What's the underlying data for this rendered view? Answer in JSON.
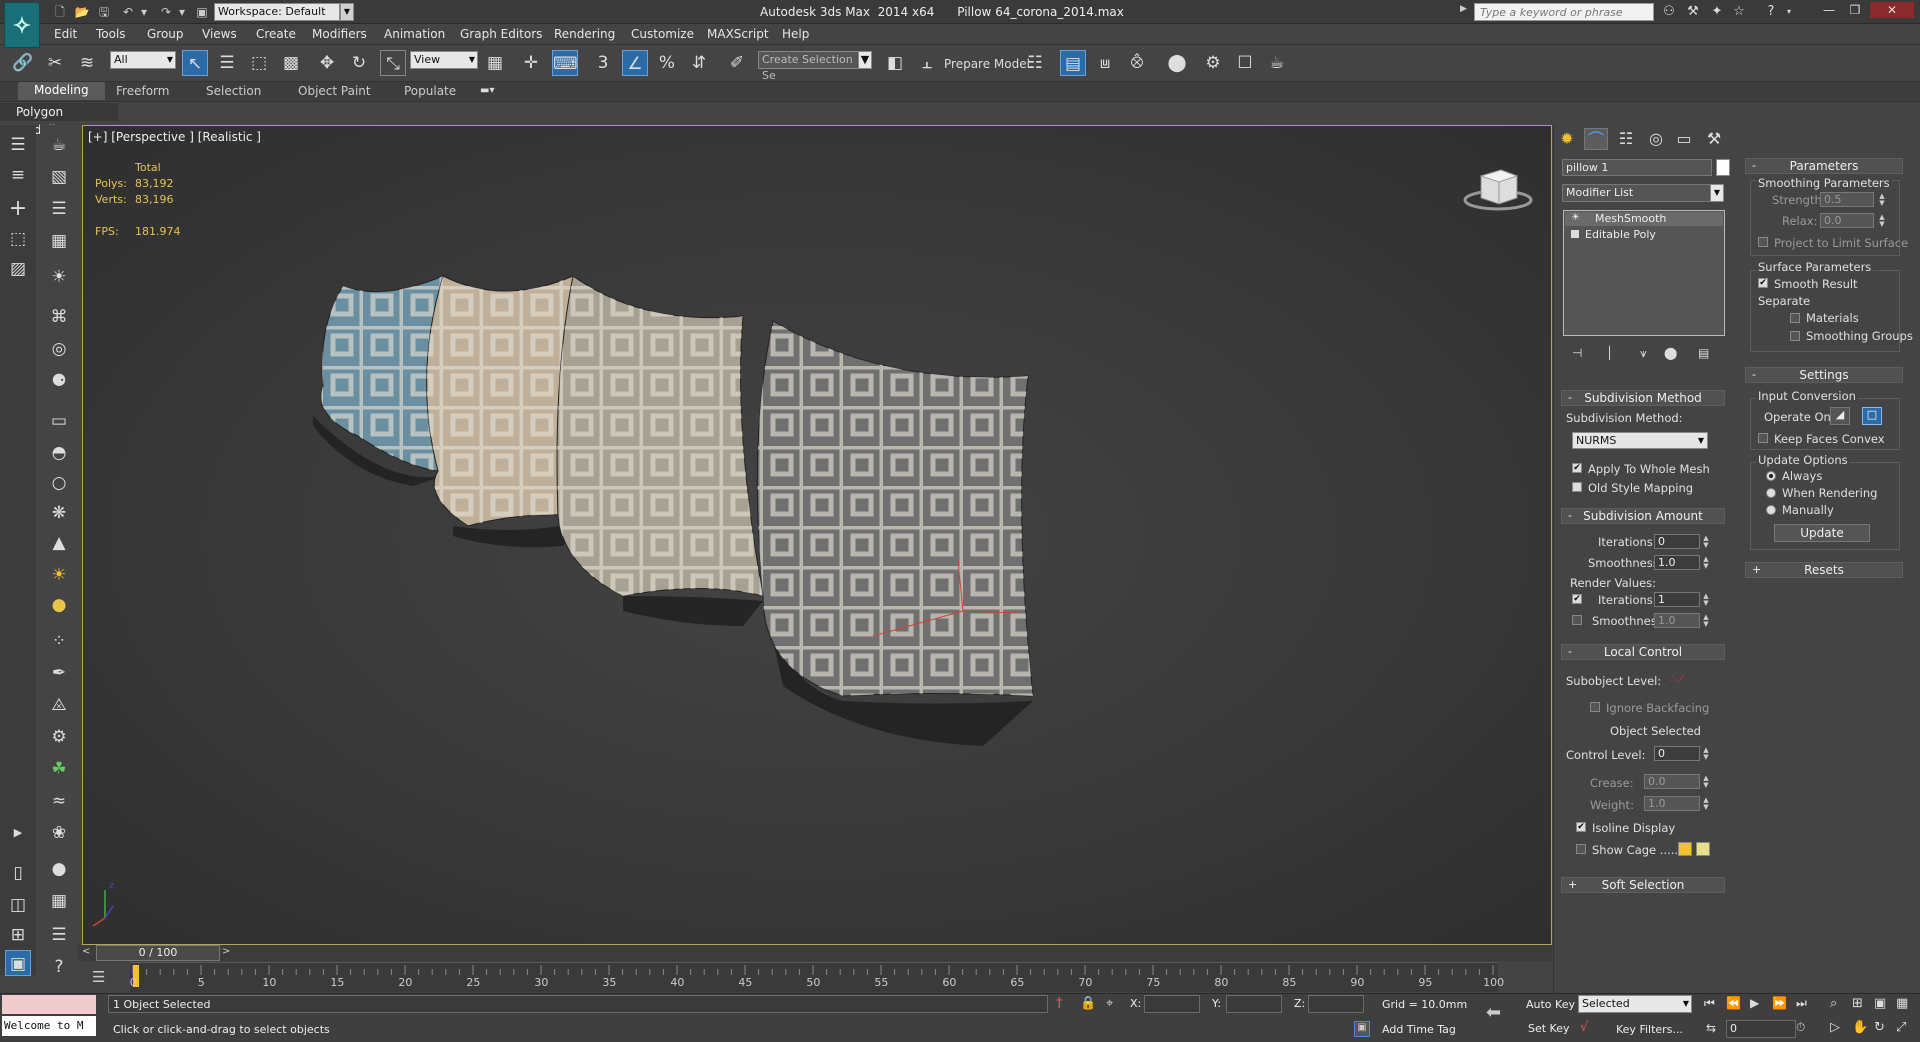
{
  "titlebar": {
    "workspace": "Workspace: Default",
    "app_title": "Autodesk 3ds Max  2014 x64      Pillow 64_corona_2014.max",
    "search_placeholder": "Type a keyword or phrase"
  },
  "menus": [
    "Edit",
    "Tools",
    "Group",
    "Views",
    "Create",
    "Modifiers",
    "Animation",
    "Graph Editors",
    "Rendering",
    "Customize",
    "MAXScript",
    "Help"
  ],
  "toolbar": {
    "selection_filter": "All",
    "ref_coord": "View",
    "snap_label": "3",
    "angle_snap_label": "%",
    "named_selection": "Create Selection Se",
    "prepare_model": "Prepare Model"
  },
  "ribbon": {
    "tabs": [
      "Modeling",
      "Freeform",
      "Selection",
      "Object Paint",
      "Populate"
    ],
    "active_tab": "Modeling",
    "sub_panel": "Polygon Modeling"
  },
  "viewport": {
    "label": "[+] [Perspective ] [Realistic ]",
    "stats_header": "Total",
    "polys_label": "Polys:",
    "polys_value": "83,192",
    "verts_label": "Verts:",
    "verts_value": "83,196",
    "fps_label": "FPS:",
    "fps_value": "181.974",
    "pillow_colors": [
      "#6a8fa0",
      "#c0b09a",
      "#a8a090",
      "#707070"
    ],
    "pattern_color": "#e0dcd2"
  },
  "timeline": {
    "slider": "0 / 100",
    "ticks": [
      "0",
      "5",
      "10",
      "15",
      "20",
      "25",
      "30",
      "35",
      "40",
      "45",
      "50",
      "55",
      "60",
      "65",
      "70",
      "75",
      "80",
      "85",
      "90",
      "95",
      "100"
    ]
  },
  "status": {
    "welcome": "Welcome to M",
    "objects_selected": "1 Object Selected",
    "prompt": "Click or click-and-drag to select objects",
    "x_label": "X:",
    "y_label": "Y:",
    "z_label": "Z:",
    "grid": "Grid = 10.0mm",
    "add_time_tag": "Add Time Tag",
    "auto_key": "Auto Key",
    "set_key": "Set Key",
    "key_mode": "Selected",
    "key_filters": "Key Filters...",
    "frame": "0"
  },
  "command_panel": {
    "object_name": "pillow 1",
    "modifier_list": "Modifier List",
    "stack": [
      "MeshSmooth",
      "Editable Poly"
    ],
    "subdivision_method": {
      "title": "Subdivision Method",
      "method_label": "Subdivision Method:",
      "method_value": "NURMS",
      "apply_whole_mesh": "Apply To Whole Mesh",
      "old_style_mapping": "Old Style Mapping"
    },
    "subdivision_amount": {
      "title": "Subdivision Amount",
      "iterations_label": "Iterations:",
      "iterations": "0",
      "smoothness_label": "Smoothness:",
      "smoothness": "1.0",
      "render_values": "Render Values:",
      "render_iterations_label": "Iterations:",
      "render_iterations": "1",
      "render_smoothness_label": "Smoothness:",
      "render_smoothness": "1.0"
    },
    "local_control": {
      "title": "Local Control",
      "subobject_level": "Subobject Level:",
      "ignore_backfacing": "Ignore Backfacing",
      "object_selected": "Object Selected",
      "control_level_label": "Control Level:",
      "control_level": "0",
      "crease_label": "Crease:",
      "crease": "0.0",
      "weight_label": "Weight:",
      "weight": "1.0",
      "isoline_display": "Isoline Display",
      "show_cage": "Show Cage ......",
      "cage_colors": [
        "#f2c12e",
        "#e8e08a"
      ]
    },
    "soft_selection": "Soft Selection",
    "parameters": {
      "title": "Parameters",
      "smoothing_parameters": "Smoothing Parameters",
      "strength_label": "Strength:",
      "strength": "0.5",
      "relax_label": "Relax:",
      "relax": "0.0",
      "project_limit": "Project to Limit Surface",
      "surface_parameters": "Surface Parameters",
      "smooth_result": "Smooth Result",
      "separate": "Separate",
      "materials": "Materials",
      "smoothing_groups": "Smoothing Groups"
    },
    "settings": {
      "title": "Settings",
      "input_conversion": "Input Conversion",
      "operate_on": "Operate On:",
      "keep_faces_convex": "Keep Faces Convex",
      "update_options": "Update Options",
      "always": "Always",
      "when_rendering": "When Rendering",
      "manually": "Manually",
      "update_button": "Update"
    },
    "resets": "Resets"
  }
}
